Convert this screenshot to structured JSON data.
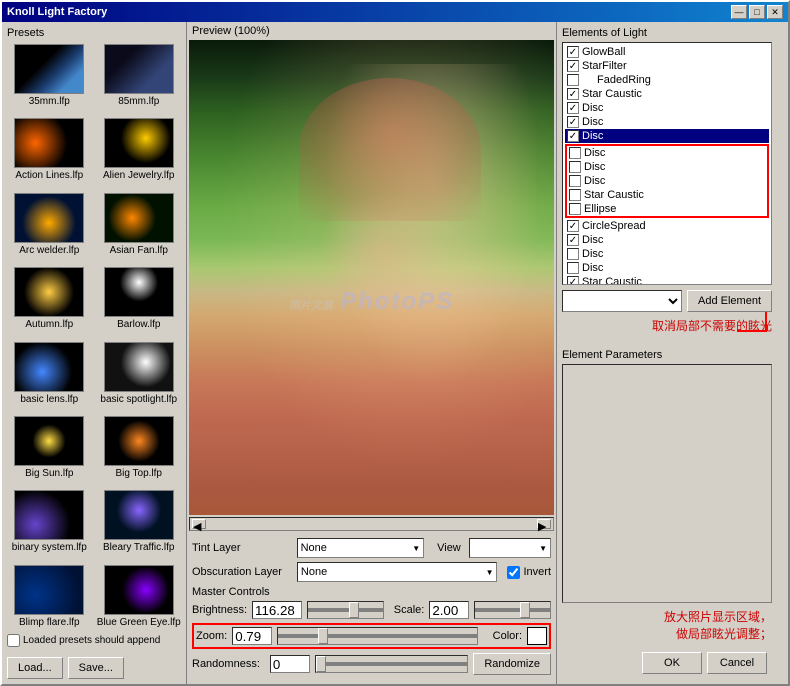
{
  "window": {
    "title": "Knoll Light Factory",
    "min_btn": "—",
    "max_btn": "□",
    "close_btn": "✕"
  },
  "presets": {
    "label": "Presets",
    "items": [
      {
        "name": "35mm.lfp",
        "thumb": "thumb-35mm"
      },
      {
        "name": "85mm.lfp",
        "thumb": "thumb-85mm"
      },
      {
        "name": "Action Lines.lfp",
        "thumb": "thumb-action"
      },
      {
        "name": "Alien Jewelry.lfp",
        "thumb": "thumb-alien"
      },
      {
        "name": "Arc welder.lfp",
        "thumb": "thumb-arc"
      },
      {
        "name": "Asian Fan.lfp",
        "thumb": "thumb-asian"
      },
      {
        "name": "Autumn.lfp",
        "thumb": "thumb-autumn"
      },
      {
        "name": "Barlow.lfp",
        "thumb": "thumb-barlow"
      },
      {
        "name": "basic lens.lfp",
        "thumb": "thumb-basic-lens"
      },
      {
        "name": "basic spotlight.lfp",
        "thumb": "thumb-basic-spot"
      },
      {
        "name": "Big Sun.lfp",
        "thumb": "thumb-big-sun"
      },
      {
        "name": "Big Top.lfp",
        "thumb": "thumb-big-top"
      },
      {
        "name": "binary system.lfp",
        "thumb": "thumb-binary"
      },
      {
        "name": "Bleary Traffic.lfp",
        "thumb": "thumb-bleary"
      },
      {
        "name": "Blimp flare.lfp",
        "thumb": "thumb-blimp"
      },
      {
        "name": "Blue Green Eye.lfp",
        "thumb": "thumb-blue-green"
      }
    ],
    "checkbox_label": "Loaded presets should append",
    "load_btn": "Load...",
    "save_btn": "Save..."
  },
  "preview": {
    "header": "Preview (100%)",
    "tint_layer_label": "Tint Layer",
    "tint_layer_value": "None",
    "view_label": "View",
    "view_value": "",
    "obscuration_label": "Obscuration Layer",
    "obscuration_value": "None",
    "invert_label": "Invert",
    "master_controls_label": "Master Controls",
    "brightness_label": "Brightness:",
    "brightness_value": "116.28",
    "scale_label": "Scale:",
    "scale_value": "2.00",
    "zoom_label": "Zoom:",
    "zoom_value": "0.79",
    "color_label": "Color:",
    "randomness_label": "Randomness:",
    "randomness_value": "0",
    "randomize_btn": "Randomize",
    "watermark": "PhotoPS"
  },
  "elements": {
    "header": "Elements of Light",
    "items": [
      {
        "name": "GlowBall",
        "checked": true,
        "indent": false
      },
      {
        "name": "StarFilter",
        "checked": true,
        "indent": false
      },
      {
        "name": "FadedRing",
        "checked": false,
        "indent": false
      },
      {
        "name": "Star Caustic",
        "checked": true,
        "indent": false
      },
      {
        "name": "Disc",
        "checked": true,
        "indent": false
      },
      {
        "name": "Disc",
        "checked": true,
        "indent": false
      },
      {
        "name": "Disc",
        "checked": true,
        "indent": false
      },
      {
        "name": "Disc",
        "checked": false,
        "indent": false,
        "highlight": true
      },
      {
        "name": "Disc",
        "checked": false,
        "indent": false,
        "highlight": true
      },
      {
        "name": "Disc",
        "checked": false,
        "indent": false,
        "highlight": true
      },
      {
        "name": "Star Caustic",
        "checked": false,
        "indent": false,
        "highlight": true
      },
      {
        "name": "Ellipse",
        "checked": false,
        "indent": false,
        "highlight": true
      },
      {
        "name": "CircleSpread",
        "checked": true,
        "indent": false
      },
      {
        "name": "Disc",
        "checked": true,
        "indent": false
      },
      {
        "name": "Disc",
        "checked": false,
        "indent": false
      },
      {
        "name": "Disc",
        "checked": false,
        "indent": false
      },
      {
        "name": "Star Caustic",
        "checked": true,
        "indent": false
      }
    ],
    "add_element_label": "Add Element",
    "element_params_label": "Element Parameters"
  },
  "annotations": {
    "cancel_flare": "取消局部不需要的眩光",
    "zoom_adjust": "放大照片显示区域，\n做局部眩光调整；"
  },
  "footer": {
    "ok_btn": "OK",
    "cancel_btn": "Cancel"
  }
}
